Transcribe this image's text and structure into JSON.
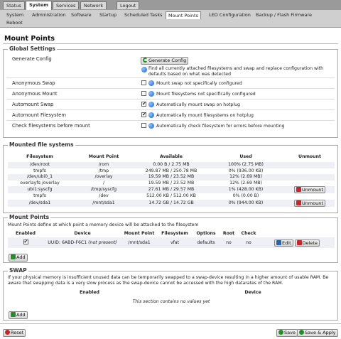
{
  "top_tabs": [
    {
      "label": "Status",
      "active": false
    },
    {
      "label": "System",
      "active": true
    },
    {
      "label": "Services",
      "active": false
    },
    {
      "label": "Network",
      "active": false
    },
    {
      "label": "Logout",
      "active": false
    }
  ],
  "sub_tabs": [
    {
      "label": "System",
      "active": false
    },
    {
      "label": "Administration",
      "active": false
    },
    {
      "label": "Software",
      "active": false
    },
    {
      "label": "Startup",
      "active": false
    },
    {
      "label": "Scheduled Tasks",
      "active": false
    },
    {
      "label": "Mount Points",
      "active": true
    },
    {
      "label": "LED Configuration",
      "active": false
    },
    {
      "label": "Backup / Flash Firmware",
      "active": false
    },
    {
      "label": "Reboot",
      "active": false
    }
  ],
  "page_title": "Mount Points",
  "global_settings": {
    "legend": "Global Settings",
    "generate_config": {
      "label": "Generate Config",
      "button": "Generate Config",
      "description": "Find all currently attached filesystems and swap and replace configuration with defaults based on what was detected"
    },
    "options": [
      {
        "label": "Anonymous Swap",
        "checked": false,
        "description": "Mount swap not specifically configured"
      },
      {
        "label": "Anonymous Mount",
        "checked": false,
        "description": "Mount filesystems not specifically configured"
      },
      {
        "label": "Automount Swap",
        "checked": true,
        "description": "Automatically mount swap on hotplug"
      },
      {
        "label": "Automount Filesystem",
        "checked": true,
        "description": "Automatically mount filesystems on hotplug"
      },
      {
        "label": "Check filesystems before mount",
        "checked": false,
        "description": "Automatically check filesystem for errors before mounting"
      }
    ]
  },
  "mounted": {
    "legend": "Mounted file systems",
    "headers": [
      "Filesystem",
      "Mount Point",
      "Available",
      "Used",
      "Unmount"
    ],
    "rows": [
      {
        "fs": "/dev/root",
        "mp": "/rom",
        "avail": "0.00 B / 2.75 MB",
        "used": "100% (2.75 MB)",
        "unmount": ""
      },
      {
        "fs": "tmpfs",
        "mp": "/tmp",
        "avail": "249.87 MB / 250.78 MB",
        "used": "0% (936.00 KB)",
        "unmount": ""
      },
      {
        "fs": "/dev/ubi0_1",
        "mp": "/overlay",
        "avail": "19.59 MB / 23.52 MB",
        "used": "12% (2.69 MB)",
        "unmount": ""
      },
      {
        "fs": "overlayfs:/overlay",
        "mp": "/",
        "avail": "19.59 MB / 23.52 MB",
        "used": "12% (2.69 MB)",
        "unmount": ""
      },
      {
        "fs": "ubi1:syscfg",
        "mp": "/tmp/syscfg",
        "avail": "27.61 MB / 29.57 MB",
        "used": "1% (428.00 KB)",
        "unmount": "Unmount"
      },
      {
        "fs": "tmpfs",
        "mp": "/dev",
        "avail": "512.00 KB / 512.00 KB",
        "used": "0% (0.00 B)",
        "unmount": ""
      },
      {
        "fs": "/dev/sda1",
        "mp": "/mnt/sda1",
        "avail": "14.72 GB / 14.72 GB",
        "used": "0% (944.00 KB)",
        "unmount": "Unmount"
      }
    ]
  },
  "mount_points": {
    "legend": "Mount Points",
    "description": "Mount Points define at which point a memory device will be attached to the filesystem",
    "headers": [
      "Enabled",
      "Device",
      "Mount Point",
      "Filesystem",
      "Options",
      "Root",
      "Check"
    ],
    "rows": [
      {
        "enabled": true,
        "device": "UUID: 6ABD-F6C1",
        "device_note": "(not present)",
        "mp": "/mnt/sda1",
        "fs": "vfat",
        "options": "defaults",
        "root": "no",
        "check": "no"
      }
    ],
    "edit": "Edit",
    "delete": "Delete",
    "add": "Add"
  },
  "swap": {
    "legend": "SWAP",
    "description": "If your physical memory is insufficient unused data can be temporarily swapped to a swap-device resulting in a higher amount of usable RAM. Be aware that swapping data is a very slow process as the swap-device cannot be accessed with the high datarates of the RAM.",
    "headers": [
      "Enabled",
      "Device"
    ],
    "empty": "This section contains no values yet",
    "add": "Add"
  },
  "footer": {
    "reset": "Reset",
    "save": "Save",
    "save_apply": "Save & Apply"
  },
  "colors": {
    "info": "#1c62c7",
    "add": "#2b8a2b",
    "delete": "#c0282d",
    "edit": "#2b62b0"
  }
}
